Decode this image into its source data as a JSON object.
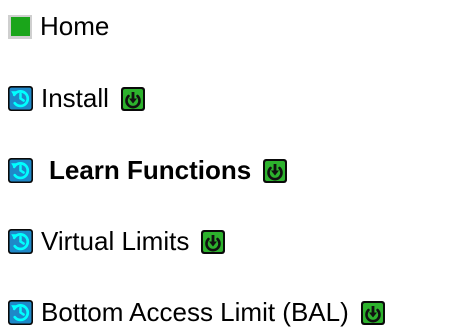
{
  "menu": {
    "items": [
      {
        "label": "Home",
        "icon": "home-square-icon",
        "emphasis": false,
        "color": "#1aa51a"
      },
      {
        "label": "Install",
        "icon": "cycle-icon",
        "badge": "down-arrow-icon",
        "emphasis": false
      },
      {
        "label": "Learn Functions",
        "icon": "cycle-icon",
        "badge": "down-arrow-icon",
        "emphasis": true
      },
      {
        "label": "Virtual Limits",
        "icon": "cycle-icon",
        "badge": "down-arrow-icon",
        "emphasis": false
      },
      {
        "label": "Bottom Access Limit (BAL)",
        "icon": "cycle-icon",
        "badge": "down-arrow-icon",
        "emphasis": false
      }
    ]
  },
  "colors": {
    "cycle_icon_bg": "#1e88c8",
    "cycle_icon_fg": "#00ffff",
    "down_icon_bg": "#2db22d",
    "home_icon": "#1aa51a"
  }
}
